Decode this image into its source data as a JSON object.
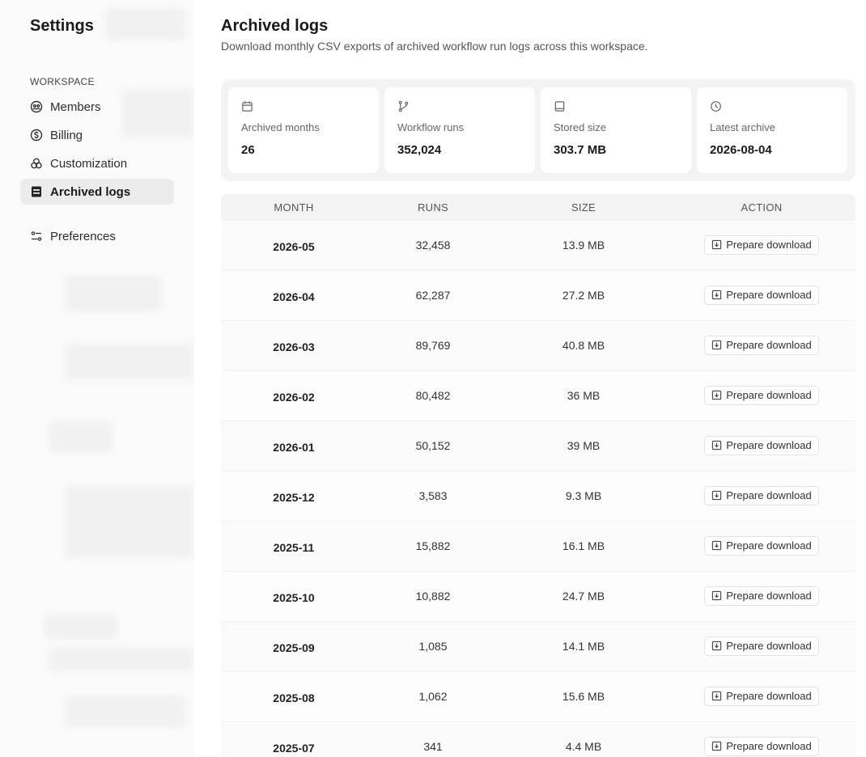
{
  "sidebar": {
    "title": "Settings",
    "section_label": "WORKSPACE",
    "items": [
      {
        "label": "Members",
        "icon": "members-icon"
      },
      {
        "label": "Billing",
        "icon": "billing-icon"
      },
      {
        "label": "Customization",
        "icon": "customization-icon"
      },
      {
        "label": "Archived logs",
        "icon": "archive-icon",
        "active": true
      },
      {
        "label": "Preferences",
        "icon": "preferences-icon"
      }
    ]
  },
  "main": {
    "title": "Archived logs",
    "subtitle": "Download monthly CSV exports of archived workflow run logs across this workspace.",
    "stats": [
      {
        "label": "Archived months",
        "value": "26",
        "icon": "calendar-icon"
      },
      {
        "label": "Workflow runs",
        "value": "352,024",
        "icon": "branch-icon"
      },
      {
        "label": "Stored size",
        "value": "303.7 MB",
        "icon": "storage-icon"
      },
      {
        "label": "Latest archive",
        "value": "2026-08-04",
        "icon": "clock-icon"
      }
    ],
    "table": {
      "headers": {
        "month": "MONTH",
        "runs": "RUNS",
        "size": "SIZE",
        "action": "ACTION"
      },
      "action_label": "Prepare download",
      "rows": [
        {
          "month": "2026-05",
          "runs": "32,458",
          "size": "13.9 MB"
        },
        {
          "month": "2026-04",
          "runs": "62,287",
          "size": "27.2 MB"
        },
        {
          "month": "2026-03",
          "runs": "89,769",
          "size": "40.8 MB"
        },
        {
          "month": "2026-02",
          "runs": "80,482",
          "size": "36 MB"
        },
        {
          "month": "2026-01",
          "runs": "50,152",
          "size": "39 MB"
        },
        {
          "month": "2025-12",
          "runs": "3,583",
          "size": "9.3 MB"
        },
        {
          "month": "2025-11",
          "runs": "15,882",
          "size": "16.1 MB"
        },
        {
          "month": "2025-10",
          "runs": "10,882",
          "size": "24.7 MB"
        },
        {
          "month": "2025-09",
          "runs": "1,085",
          "size": "14.1 MB"
        },
        {
          "month": "2025-08",
          "runs": "1,062",
          "size": "15.6 MB"
        },
        {
          "month": "2025-07",
          "runs": "341",
          "size": "4.4 MB"
        }
      ]
    }
  }
}
